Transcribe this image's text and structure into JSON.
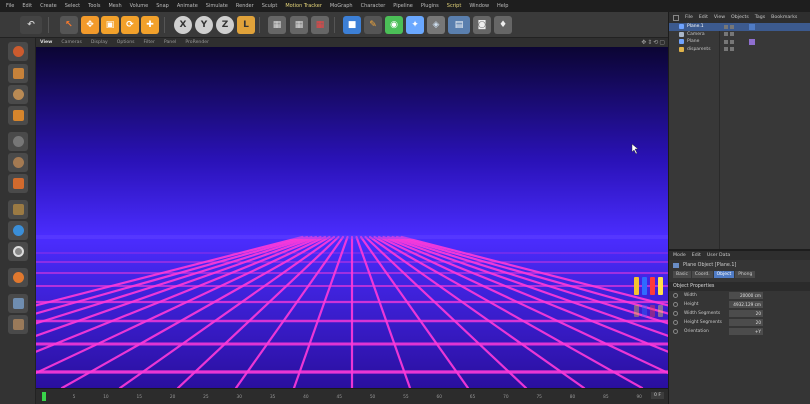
{
  "menu": [
    "File",
    "Edit",
    "Create",
    "Select",
    "Tools",
    "Mesh",
    "Volume",
    "Snap",
    "Animate",
    "Simulate",
    "Render",
    "Sculpt",
    "Motion Tracker",
    "MoGraph",
    "Character",
    "Pipeline",
    "Plugins",
    "Script",
    "Window",
    "Help"
  ],
  "viewport": {
    "tabs": [
      "View",
      "Cameras",
      "Display",
      "Options",
      "Filter",
      "Panel",
      "ProRender"
    ],
    "nav_icons": "✥⇕⟲▢",
    "sky_top": "#0b0533",
    "sky_mid": "#2a12b8",
    "horizon": "#4b2dff",
    "floor": "#2a0f9e",
    "grid_color": "#ff3ad9"
  },
  "timeline": {
    "ticks": [
      "0",
      "5",
      "10",
      "15",
      "20",
      "25",
      "30",
      "35",
      "40",
      "45",
      "50",
      "55",
      "60",
      "65",
      "70",
      "75",
      "80",
      "85",
      "90"
    ],
    "end_label": "0 F"
  },
  "object_manager": {
    "menu": [
      "File",
      "Edit",
      "View",
      "Objects",
      "Tags",
      "Bookmarks"
    ],
    "objects": [
      {
        "name": "Plane.1",
        "selected": true,
        "color": "#6fa3ff"
      },
      {
        "name": "Camera",
        "selected": false,
        "color": "#aab7c9"
      },
      {
        "name": "Plane",
        "selected": false,
        "color": "#6fa3ff"
      },
      {
        "name": "disparents",
        "selected": false,
        "color": "#e0b34a"
      }
    ]
  },
  "attributes": {
    "menu": [
      "Mode",
      "Edit",
      "User Data"
    ],
    "title": "Plane Object [Plane.1]",
    "tabs": [
      "Basic",
      "Coord.",
      "Object",
      "Phong"
    ],
    "active_tab": "Object",
    "section": "Object Properties",
    "fields": [
      {
        "label": "Width",
        "value": "20000 cm"
      },
      {
        "label": "Height",
        "value": "4932.129 cm"
      },
      {
        "label": "Width Segments",
        "value": "20"
      },
      {
        "label": "Height Segments",
        "value": "20"
      },
      {
        "label": "Orientation",
        "value": "+Y"
      }
    ]
  }
}
